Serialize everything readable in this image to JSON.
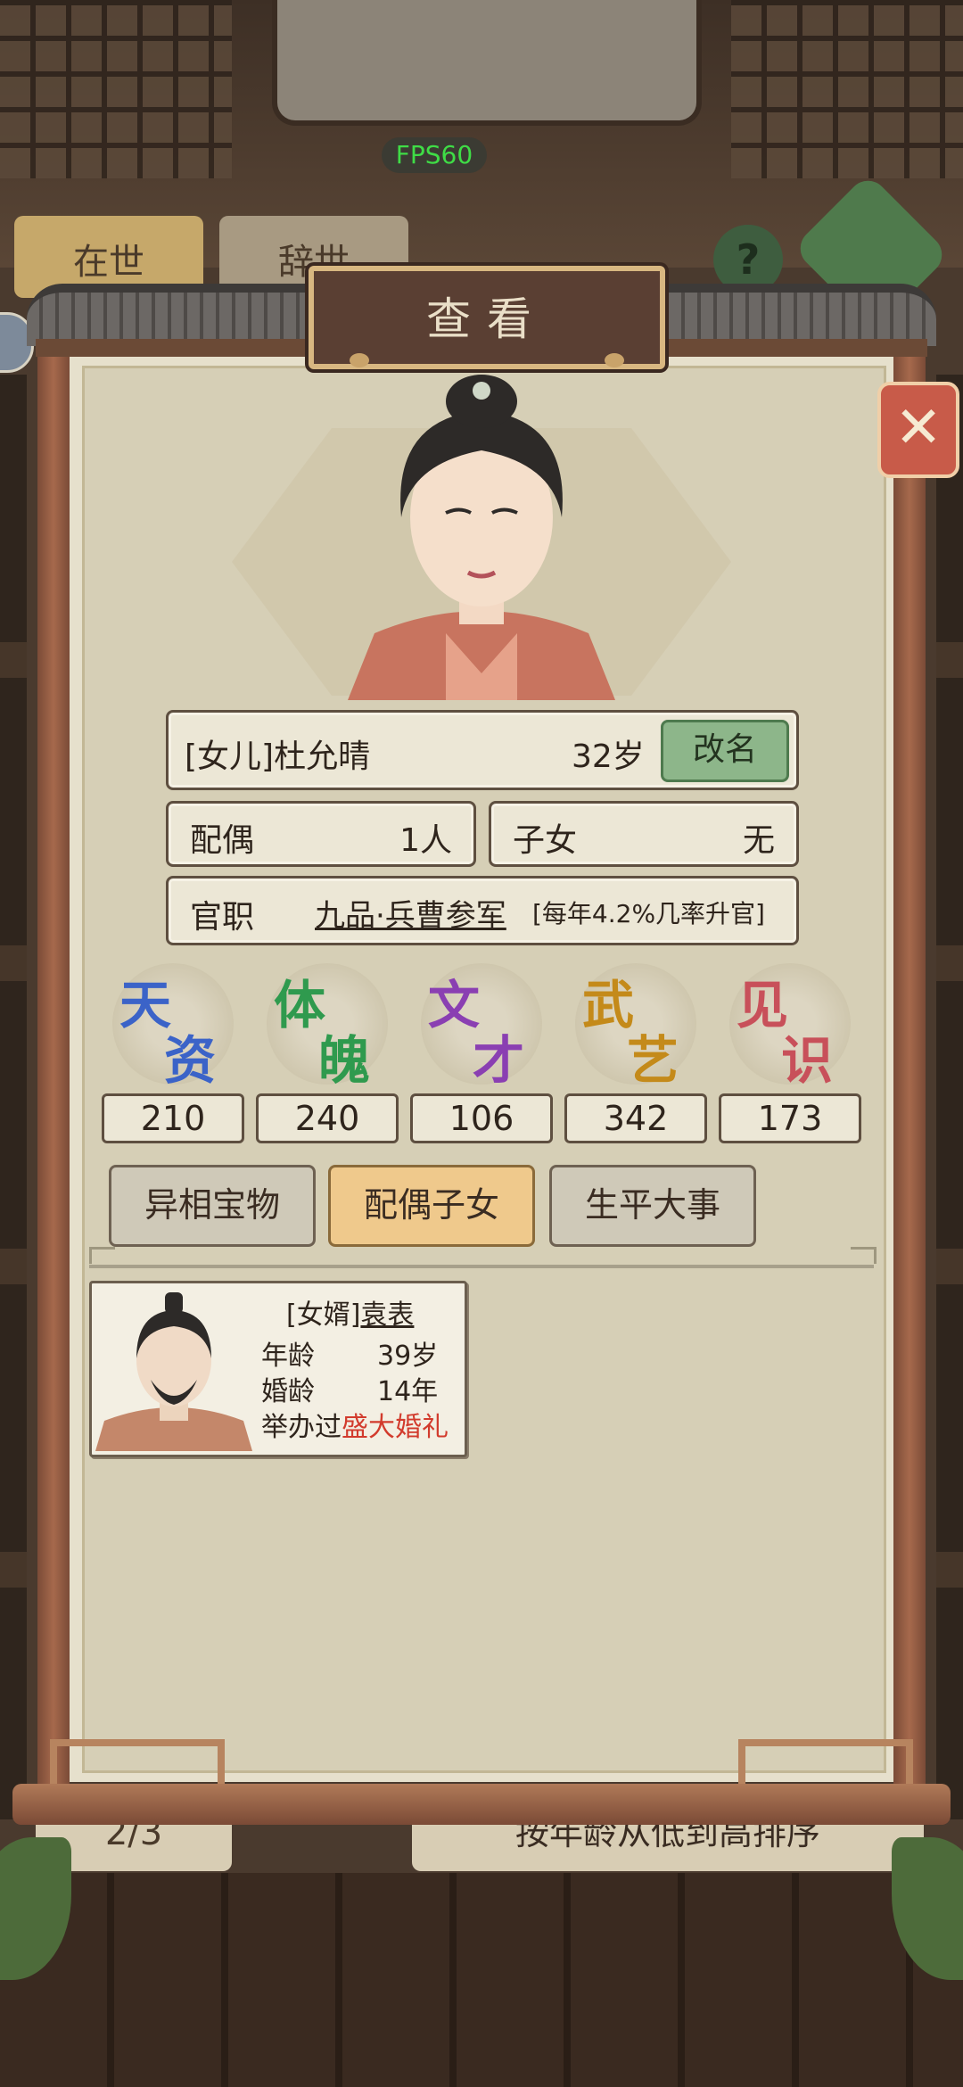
{
  "background": {
    "fps": "FPS60",
    "tabs": [
      "在世",
      "辞世"
    ],
    "help_label": "?",
    "pager": "2/3",
    "sort_label": "按年龄从低到高排序"
  },
  "dialog": {
    "title": "查看",
    "close_label": "✕"
  },
  "person": {
    "name": "[女儿]杜允晴",
    "age": "32岁",
    "rename_button": "改名",
    "spouse_label": "配偶",
    "spouse_value": "1人",
    "children_label": "子女",
    "children_value": "无",
    "office_label": "官职",
    "office_value": "九品·兵曹参军",
    "office_rate": "[每年4.2%几率升官]"
  },
  "stats": [
    {
      "c1": "天",
      "c2": "资",
      "value": "210",
      "color": "#3b63c8"
    },
    {
      "c1": "体",
      "c2": "魄",
      "value": "240",
      "color": "#2f9a4e"
    },
    {
      "c1": "文",
      "c2": "才",
      "value": "106",
      "color": "#8a3fb2"
    },
    {
      "c1": "武",
      "c2": "艺",
      "value": "342",
      "color": "#c48a1a"
    },
    {
      "c1": "见",
      "c2": "识",
      "value": "173",
      "color": "#c8505a"
    }
  ],
  "tabs": [
    "异相宝物",
    "配偶子女",
    "生平大事"
  ],
  "spouse_card": {
    "relation_prefix": "[女婿]",
    "name": "袁表",
    "age_label": "年龄",
    "age_value": "39岁",
    "marriage_label": "婚龄",
    "marriage_value": "14年",
    "wedding_prefix": "举办过",
    "wedding_value": "盛大婚礼"
  },
  "colors": {
    "accent_green": "#8db68a",
    "close_red": "#c85b49",
    "wedding_red": "#d23b2d",
    "active_tab": "#efc98c"
  }
}
